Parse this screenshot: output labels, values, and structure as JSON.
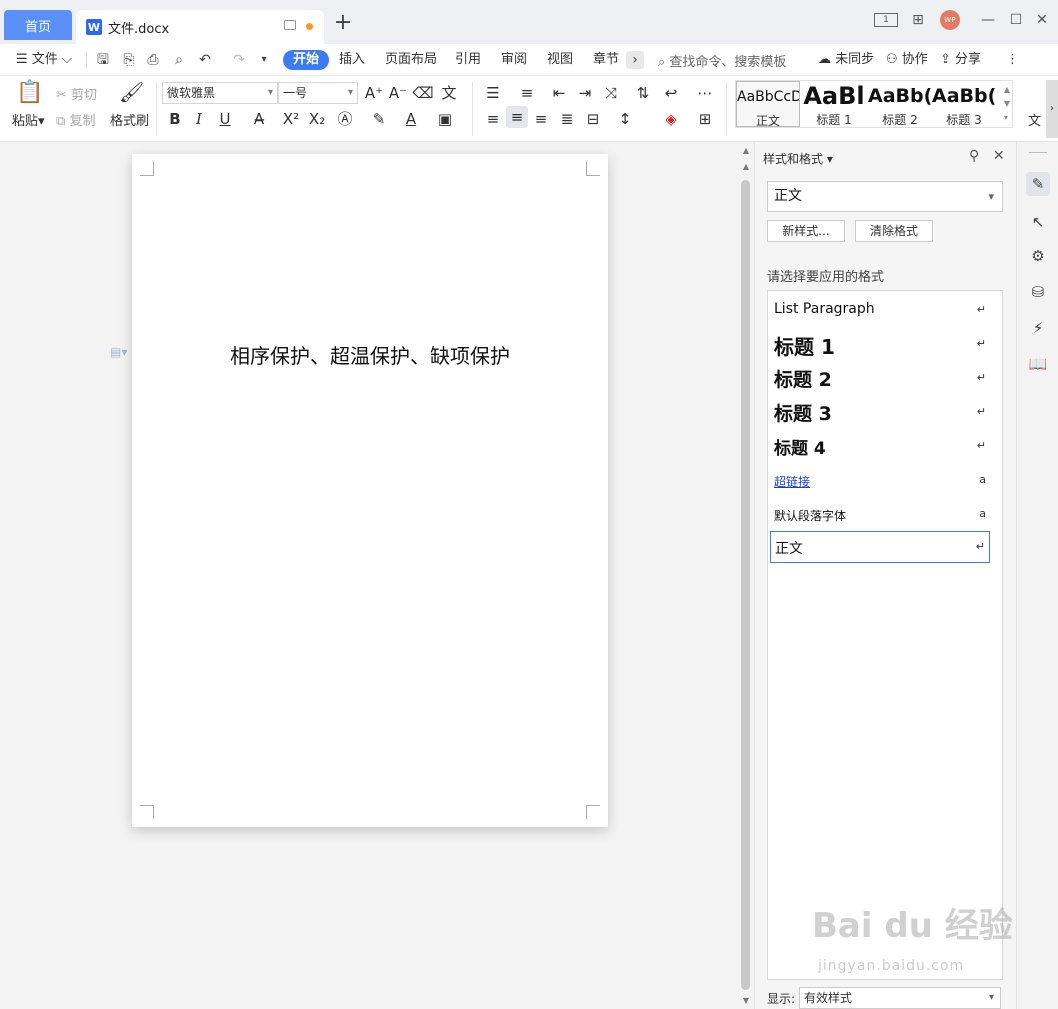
{
  "titlebar": {
    "home_tab": "首页",
    "doc_tab": "文件.docx",
    "doc_icon": "W",
    "avatar": "WP"
  },
  "menu": {
    "file": "文件",
    "items": [
      "开始",
      "插入",
      "页面布局",
      "引用",
      "审阅",
      "视图",
      "章节"
    ],
    "search": "查找命令、搜索模板",
    "unsync": "未同步",
    "collab": "协作",
    "share": "分享"
  },
  "ribbon": {
    "paste": "粘贴",
    "cut": "剪切",
    "copy": "复制",
    "format_painter": "格式刷",
    "font_family": "微软雅黑",
    "font_size": "一号",
    "styles": [
      {
        "preview": "AaBbCcDd",
        "name": "正文"
      },
      {
        "preview": "AaBl",
        "name": "标题 1"
      },
      {
        "preview": "AaBb(",
        "name": "标题 2"
      },
      {
        "preview": "AaBb(",
        "name": "标题 3"
      }
    ],
    "text_tool": "文"
  },
  "document": {
    "text": "相序保护、超温保护、缺项保护"
  },
  "pane": {
    "title": "样式和格式",
    "current_style": "正文",
    "new_style": "新样式...",
    "clear_format": "清除格式",
    "prompt": "请选择要应用的格式",
    "styles": [
      {
        "label": "List Paragraph",
        "mark": "↵"
      },
      {
        "label": "标题 1",
        "mark": "↵"
      },
      {
        "label": "标题 2",
        "mark": "↵"
      },
      {
        "label": "标题 3",
        "mark": "↵"
      },
      {
        "label": "标题 4",
        "mark": "↵"
      },
      {
        "label": "超链接",
        "mark": "a"
      },
      {
        "label": "默认段落字体",
        "mark": "a"
      },
      {
        "label": "正文",
        "mark": "↵"
      }
    ],
    "show_label": "显示:",
    "show_value": "有效样式"
  },
  "watermark": {
    "main": "Bai du 经验",
    "sub": "jingyan.baidu.com"
  },
  "colors": {
    "accent": "#3b7cf5",
    "home_tab": "#5b8ff9",
    "avatar": "#e47a63"
  }
}
